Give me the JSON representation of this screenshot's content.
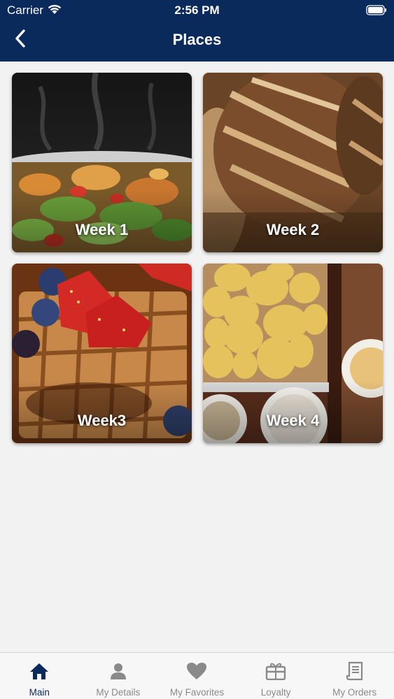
{
  "status_bar": {
    "carrier": "Carrier",
    "time": "2:56 PM"
  },
  "header": {
    "title": "Places",
    "back_icon": "chevron-left-icon"
  },
  "colors": {
    "header_bg": "#0a2a5c",
    "active_tab": "#0a2a5c",
    "inactive_tab": "#8a8a8a",
    "background": "#f2f2f2"
  },
  "places": [
    {
      "label": "Week 1",
      "image": "salad-photo"
    },
    {
      "label": "Week 2",
      "image": "bread-photo"
    },
    {
      "label": "Week3",
      "image": "waffles-photo"
    },
    {
      "label": "Week 4",
      "image": "potatoes-photo"
    }
  ],
  "tabs": [
    {
      "label": "Main",
      "icon": "home-icon",
      "active": true
    },
    {
      "label": "My Details",
      "icon": "person-icon",
      "active": false
    },
    {
      "label": "My Favorites",
      "icon": "heart-icon",
      "active": false
    },
    {
      "label": "Loyalty",
      "icon": "gift-card-icon",
      "active": false
    },
    {
      "label": "My Orders",
      "icon": "receipt-icon",
      "active": false
    }
  ]
}
